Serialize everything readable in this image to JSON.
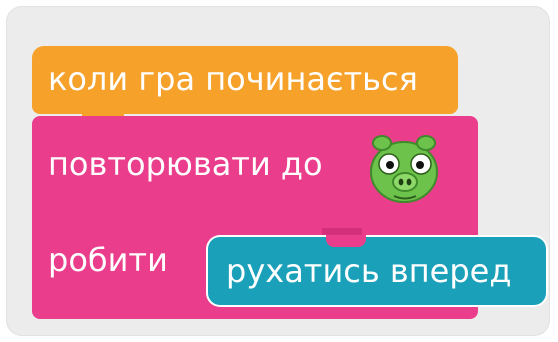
{
  "workspace": {
    "hat_block": {
      "label": "коли гра починається"
    },
    "repeat_until_block": {
      "condition_label": "повторювати до",
      "condition_sensor": "pig-icon",
      "body_label": "робити"
    },
    "motion_block": {
      "label": "рухатись вперед"
    }
  },
  "colors": {
    "event": "#f5a12a",
    "control": "#ea3d8c",
    "motion": "#1aa1b9",
    "workspace": "#ececec",
    "pig": "#6cc24a"
  }
}
